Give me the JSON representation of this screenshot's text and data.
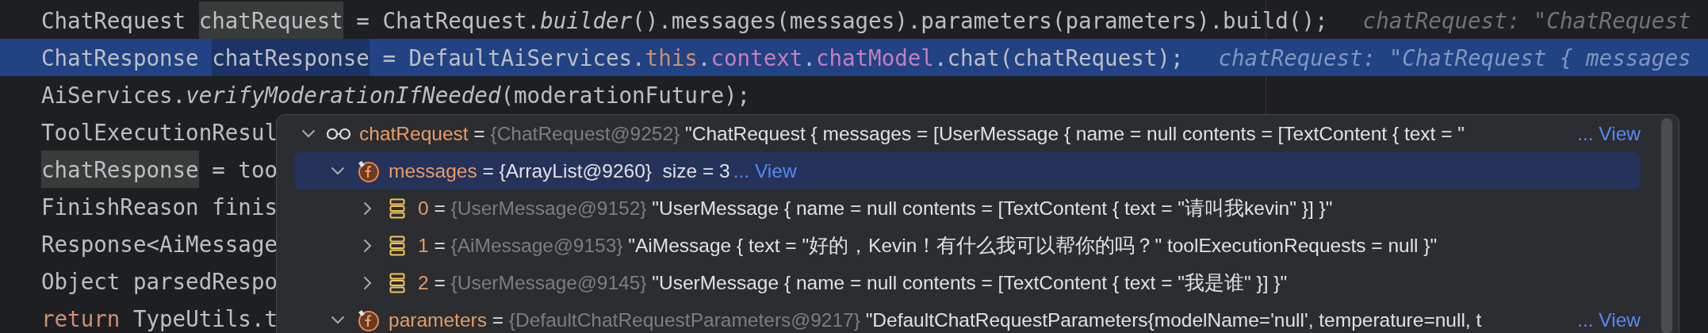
{
  "editor": {
    "lines": [
      {
        "selected": false,
        "segments": [
          {
            "text": "ChatRequest ",
            "kind": "plain"
          },
          {
            "text": "chatRequest",
            "kind": "usage"
          },
          {
            "text": " = ChatRequest.",
            "kind": "plain"
          },
          {
            "text": "builder",
            "kind": "static"
          },
          {
            "text": "().messages(messages).parameters(parameters).build();",
            "kind": "plain"
          }
        ],
        "hint": "chatRequest: \"ChatRequest"
      },
      {
        "selected": true,
        "segments": [
          {
            "text": "ChatResponse ",
            "kind": "plain"
          },
          {
            "text": "chatResponse",
            "kind": "write"
          },
          {
            "text": " = DefaultAiServices.",
            "kind": "plain"
          },
          {
            "text": "this",
            "kind": "keyword"
          },
          {
            "text": ".",
            "kind": "plain"
          },
          {
            "text": "context",
            "kind": "field"
          },
          {
            "text": ".",
            "kind": "plain"
          },
          {
            "text": "chatModel",
            "kind": "field"
          },
          {
            "text": ".chat(chatRequest);",
            "kind": "plain"
          }
        ],
        "hint": "chatRequest: \"ChatRequest { messages"
      },
      {
        "selected": false,
        "segments": [
          {
            "text": "AiServices.",
            "kind": "plain"
          },
          {
            "text": "verifyModerationIfNeeded",
            "kind": "static"
          },
          {
            "text": "(moderationFuture);",
            "kind": "plain"
          }
        ]
      },
      {
        "selected": false,
        "segments": [
          {
            "text": "ToolExecutionResul",
            "kind": "plain"
          }
        ]
      },
      {
        "selected": false,
        "segments": [
          {
            "text": "chatResponse",
            "kind": "usage"
          },
          {
            "text": " = too",
            "kind": "plain"
          }
        ]
      },
      {
        "selected": false,
        "segments": [
          {
            "text": "FinishReason finis",
            "kind": "plain"
          }
        ]
      },
      {
        "selected": false,
        "segments": [
          {
            "text": "Response<AiMessage",
            "kind": "plain"
          }
        ]
      },
      {
        "selected": false,
        "segments": [
          {
            "text": "Object parsedRespo",
            "kind": "plain"
          }
        ]
      },
      {
        "selected": false,
        "segments": [
          {
            "text": "return",
            "kind": "keyword"
          },
          {
            "text": " TypeUtils.t",
            "kind": "plain"
          }
        ]
      }
    ]
  },
  "debug_popup": {
    "nodes": [
      {
        "kind": "watch",
        "expanded": true,
        "selected": false,
        "name": "chatRequest",
        "op": "=",
        "type": "{ChatRequest@9252}",
        "value": "\"ChatRequest { messages = [UserMessage { name = null contents = [TextContent { text = \"",
        "link": "... View",
        "children": [
          {
            "kind": "field",
            "expanded": true,
            "selected": true,
            "name": "messages",
            "op": "=",
            "type": "{ArrayList@9260}",
            "value": "size = 3",
            "link": "... View",
            "children": [
              {
                "kind": "element",
                "expanded": false,
                "selected": false,
                "name": "0",
                "op": "=",
                "type": "{UserMessage@9152}",
                "value": "\"UserMessage { name = null contents = [TextContent { text = \"请叫我kevin\" }] }\""
              },
              {
                "kind": "element",
                "expanded": false,
                "selected": false,
                "name": "1",
                "op": "=",
                "type": "{AiMessage@9153}",
                "value": "\"AiMessage { text = \"好的，Kevin！有什么我可以帮你的吗？\" toolExecutionRequests = null }\""
              },
              {
                "kind": "element",
                "expanded": false,
                "selected": false,
                "name": "2",
                "op": "=",
                "type": "{UserMessage@9145}",
                "value": "\"UserMessage { name = null contents = [TextContent { text = \"我是谁\" }] }\""
              }
            ]
          },
          {
            "kind": "field",
            "expanded": true,
            "selected": false,
            "name": "parameters",
            "op": "=",
            "type": "{DefaultChatRequestParameters@9217}",
            "value": "\"DefaultChatRequestParameters{modelName='null', temperature=null, t",
            "link": "... View"
          }
        ]
      }
    ]
  }
}
